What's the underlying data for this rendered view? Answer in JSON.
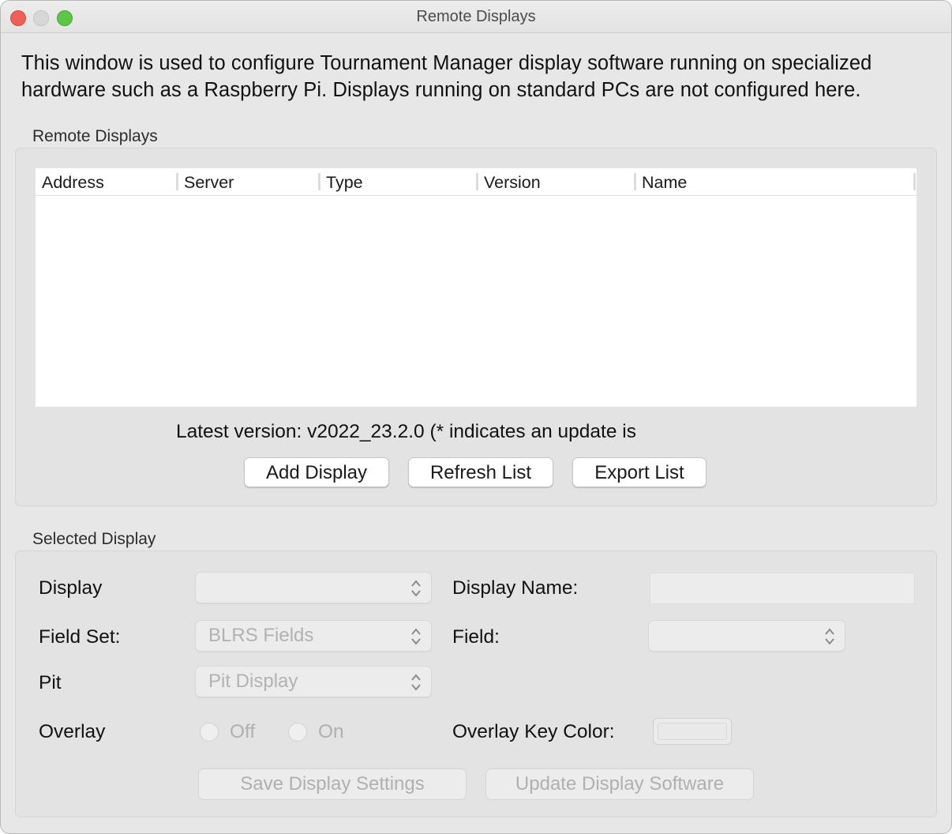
{
  "window": {
    "title": "Remote Displays"
  },
  "intro": {
    "text": "This window is used to configure Tournament Manager display software running on specialized hardware such as a Raspberry Pi. Displays running on standard PCs are not configured here."
  },
  "remote_displays": {
    "group_title": "Remote Displays",
    "columns": [
      "Address",
      "Server",
      "Type",
      "Version",
      "Name"
    ],
    "rows": [],
    "version_line": "Latest version: v2022_23.2.0 (* indicates an update is",
    "buttons": {
      "add": "Add Display",
      "refresh": "Refresh List",
      "export": "Export List"
    }
  },
  "selected_display": {
    "group_title": "Selected Display",
    "display_label": "Display",
    "display_value": "",
    "display_name_label": "Display Name:",
    "display_name_value": "",
    "field_set_label": "Field Set:",
    "field_set_value": "BLRS Fields",
    "field_label": "Field:",
    "field_value": "",
    "pit_label": "Pit",
    "pit_value": "Pit Display",
    "overlay_label": "Overlay",
    "overlay_off": "Off",
    "overlay_on": "On",
    "overlay_key_color_label": "Overlay Key Color:",
    "save_button": "Save Display Settings",
    "update_button": "Update Display Software",
    "disabled": true
  },
  "colors": {
    "close": "#ee5f57",
    "minimize": "#d7d7d7",
    "maximize": "#5ec548",
    "window_bg": "#e7e7e7",
    "disabled_text": "#b0b0b0"
  }
}
